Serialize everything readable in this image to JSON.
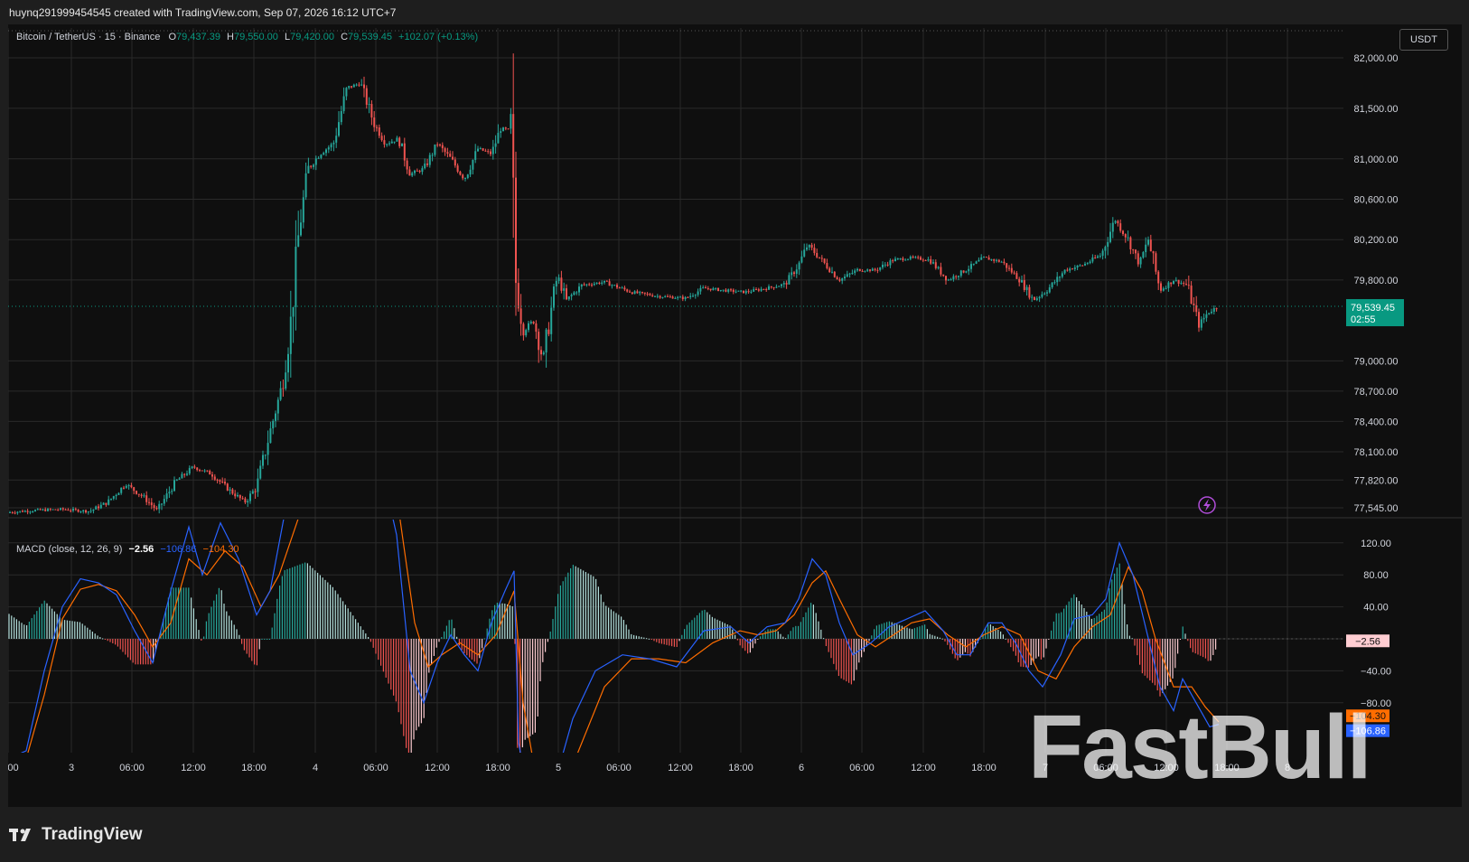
{
  "header": {
    "text": "huynq291999454545 created with TradingView.com, Sep 07, 2026 16:12 UTC+7"
  },
  "legend": {
    "symbol": "Bitcoin / TetherUS · 15 · Binance",
    "o_label": "O",
    "o": "79,437.39",
    "h_label": "H",
    "h": "79,550.00",
    "l_label": "L",
    "l": "79,420.00",
    "c_label": "C",
    "c": "79,539.45",
    "change": "+102.07 (+0.13%)"
  },
  "currency_button": "USDT",
  "price_tag": {
    "price": "79,539.45",
    "countdown": "02:55"
  },
  "macd_legend": {
    "title": "MACD (close, 12, 26, 9)",
    "hist": "−2.56",
    "macd": "−106.86",
    "signal": "−104.30"
  },
  "macd_tags": {
    "hist": "−2.56",
    "signal": "−104.30",
    "macd": "−106.86"
  },
  "footer": {
    "brand": "TradingView"
  },
  "watermark": {
    "text": "FastBull"
  },
  "colors": {
    "up": "#26a69a",
    "down": "#ef5350",
    "macd": "#2962ff",
    "signal": "#ff6d00",
    "price_tag": "#089981"
  },
  "chart_data": [
    {
      "type": "candlestick",
      "title": "Bitcoin / TetherUS · 15 · Binance",
      "price_axis_ticks": [
        82000,
        81500,
        81000,
        80600,
        80200,
        79800,
        79000,
        78700,
        78400,
        78100,
        77820,
        77545
      ],
      "price_axis_labels": [
        "82,000.00",
        "81,500.00",
        "81,000.00",
        "80,600.00",
        "80,200.00",
        "79,800.00",
        "79,000.00",
        "78,700.00",
        "78,400.00",
        "78,100.00",
        "77,820.00",
        "77,545.00"
      ],
      "time_axis_labels": [
        ":00",
        "3",
        "06:00",
        "12:00",
        "18:00",
        "4",
        "06:00",
        "12:00",
        "18:00",
        "5",
        "06:00",
        "12:00",
        "18:00",
        "6",
        "06:00",
        "12:00",
        "18:00",
        "7",
        "06:00",
        "12:00",
        "18:00",
        "8"
      ],
      "last_price": 79539.45,
      "close_path": [
        {
          "x": 0,
          "y": 77500
        },
        {
          "x": 30,
          "y": 77520
        },
        {
          "x": 60,
          "y": 77530
        },
        {
          "x": 90,
          "y": 77510
        },
        {
          "x": 110,
          "y": 77600
        },
        {
          "x": 130,
          "y": 77780
        },
        {
          "x": 150,
          "y": 77650
        },
        {
          "x": 165,
          "y": 77520
        },
        {
          "x": 185,
          "y": 77800
        },
        {
          "x": 205,
          "y": 77950
        },
        {
          "x": 225,
          "y": 77880
        },
        {
          "x": 245,
          "y": 77720
        },
        {
          "x": 262,
          "y": 77600
        },
        {
          "x": 275,
          "y": 77750
        },
        {
          "x": 290,
          "y": 78300
        },
        {
          "x": 303,
          "y": 78750
        },
        {
          "x": 312,
          "y": 79300
        },
        {
          "x": 322,
          "y": 80300
        },
        {
          "x": 332,
          "y": 80900
        },
        {
          "x": 345,
          "y": 81050
        },
        {
          "x": 360,
          "y": 81150
        },
        {
          "x": 375,
          "y": 81700
        },
        {
          "x": 390,
          "y": 81750
        },
        {
          "x": 405,
          "y": 81350
        },
        {
          "x": 418,
          "y": 81150
        },
        {
          "x": 432,
          "y": 81200
        },
        {
          "x": 445,
          "y": 80850
        },
        {
          "x": 460,
          "y": 80900
        },
        {
          "x": 475,
          "y": 81150
        },
        {
          "x": 490,
          "y": 81000
        },
        {
          "x": 505,
          "y": 80800
        },
        {
          "x": 520,
          "y": 81100
        },
        {
          "x": 535,
          "y": 81050
        },
        {
          "x": 545,
          "y": 81300
        },
        {
          "x": 557,
          "y": 81280
        },
        {
          "x": 561,
          "y": 79850
        },
        {
          "x": 570,
          "y": 79300
        },
        {
          "x": 582,
          "y": 79400
        },
        {
          "x": 592,
          "y": 79000
        },
        {
          "x": 600,
          "y": 79450
        },
        {
          "x": 608,
          "y": 79850
        },
        {
          "x": 618,
          "y": 79600
        },
        {
          "x": 635,
          "y": 79750
        },
        {
          "x": 660,
          "y": 79780
        },
        {
          "x": 690,
          "y": 79680
        },
        {
          "x": 720,
          "y": 79640
        },
        {
          "x": 750,
          "y": 79620
        },
        {
          "x": 770,
          "y": 79720
        },
        {
          "x": 790,
          "y": 79700
        },
        {
          "x": 815,
          "y": 79680
        },
        {
          "x": 840,
          "y": 79720
        },
        {
          "x": 860,
          "y": 79760
        },
        {
          "x": 875,
          "y": 79950
        },
        {
          "x": 885,
          "y": 80150
        },
        {
          "x": 900,
          "y": 80000
        },
        {
          "x": 920,
          "y": 79800
        },
        {
          "x": 940,
          "y": 79900
        },
        {
          "x": 960,
          "y": 79900
        },
        {
          "x": 980,
          "y": 80000
        },
        {
          "x": 1000,
          "y": 80020
        },
        {
          "x": 1020,
          "y": 80000
        },
        {
          "x": 1040,
          "y": 79800
        },
        {
          "x": 1060,
          "y": 79900
        },
        {
          "x": 1080,
          "y": 80020
        },
        {
          "x": 1100,
          "y": 79980
        },
        {
          "x": 1120,
          "y": 79800
        },
        {
          "x": 1135,
          "y": 79600
        },
        {
          "x": 1150,
          "y": 79700
        },
        {
          "x": 1170,
          "y": 79900
        },
        {
          "x": 1190,
          "y": 79950
        },
        {
          "x": 1210,
          "y": 80050
        },
        {
          "x": 1225,
          "y": 80400
        },
        {
          "x": 1240,
          "y": 80200
        },
        {
          "x": 1252,
          "y": 79950
        },
        {
          "x": 1262,
          "y": 80200
        },
        {
          "x": 1275,
          "y": 79700
        },
        {
          "x": 1290,
          "y": 79800
        },
        {
          "x": 1305,
          "y": 79750
        },
        {
          "x": 1318,
          "y": 79350
        },
        {
          "x": 1328,
          "y": 79480
        },
        {
          "x": 1340,
          "y": 79540
        }
      ]
    },
    {
      "type": "line",
      "title": "MACD (close, 12, 26, 9)",
      "y_axis_ticks": [
        120,
        80,
        40,
        0,
        -40,
        -80
      ],
      "y_axis_labels": [
        "120.00",
        "80.00",
        "40.00",
        "−2.56",
        "−40.00",
        "−80.00"
      ],
      "last_values": {
        "histogram": -2.56,
        "macd": -106.86,
        "signal": -104.3
      },
      "series": [
        {
          "name": "MACD",
          "points": [
            {
              "x": 0,
              "y": -150
            },
            {
              "x": 20,
              "y": -140
            },
            {
              "x": 40,
              "y": -40
            },
            {
              "x": 60,
              "y": 40
            },
            {
              "x": 80,
              "y": 75
            },
            {
              "x": 100,
              "y": 70
            },
            {
              "x": 120,
              "y": 55
            },
            {
              "x": 140,
              "y": 10
            },
            {
              "x": 160,
              "y": -30
            },
            {
              "x": 180,
              "y": 60
            },
            {
              "x": 200,
              "y": 140
            },
            {
              "x": 215,
              "y": 80
            },
            {
              "x": 235,
              "y": 145
            },
            {
              "x": 255,
              "y": 100
            },
            {
              "x": 275,
              "y": 30
            },
            {
              "x": 290,
              "y": 60
            },
            {
              "x": 305,
              "y": 150
            },
            {
              "x": 330,
              "y": 240
            },
            {
              "x": 360,
              "y": 300
            },
            {
              "x": 400,
              "y": 280
            },
            {
              "x": 430,
              "y": 130
            },
            {
              "x": 445,
              "y": -40
            },
            {
              "x": 460,
              "y": -80
            },
            {
              "x": 475,
              "y": -30
            },
            {
              "x": 490,
              "y": 5
            },
            {
              "x": 505,
              "y": -20
            },
            {
              "x": 520,
              "y": -40
            },
            {
              "x": 535,
              "y": 20
            },
            {
              "x": 550,
              "y": 60
            },
            {
              "x": 560,
              "y": 85
            },
            {
              "x": 565,
              "y": -130
            },
            {
              "x": 585,
              "y": -250
            },
            {
              "x": 600,
              "y": -200
            },
            {
              "x": 625,
              "y": -100
            },
            {
              "x": 650,
              "y": -40
            },
            {
              "x": 680,
              "y": -20
            },
            {
              "x": 710,
              "y": -25
            },
            {
              "x": 740,
              "y": -35
            },
            {
              "x": 770,
              "y": 10
            },
            {
              "x": 800,
              "y": 15
            },
            {
              "x": 820,
              "y": -5
            },
            {
              "x": 840,
              "y": 15
            },
            {
              "x": 860,
              "y": 20
            },
            {
              "x": 875,
              "y": 50
            },
            {
              "x": 890,
              "y": 100
            },
            {
              "x": 905,
              "y": 80
            },
            {
              "x": 920,
              "y": 20
            },
            {
              "x": 935,
              "y": -20
            },
            {
              "x": 955,
              "y": -5
            },
            {
              "x": 975,
              "y": 15
            },
            {
              "x": 995,
              "y": 25
            },
            {
              "x": 1015,
              "y": 35
            },
            {
              "x": 1035,
              "y": 10
            },
            {
              "x": 1050,
              "y": -20
            },
            {
              "x": 1065,
              "y": -20
            },
            {
              "x": 1085,
              "y": 20
            },
            {
              "x": 1100,
              "y": 20
            },
            {
              "x": 1115,
              "y": -5
            },
            {
              "x": 1130,
              "y": -40
            },
            {
              "x": 1145,
              "y": -60
            },
            {
              "x": 1165,
              "y": -20
            },
            {
              "x": 1180,
              "y": 25
            },
            {
              "x": 1200,
              "y": 30
            },
            {
              "x": 1215,
              "y": 50
            },
            {
              "x": 1230,
              "y": 120
            },
            {
              "x": 1245,
              "y": 80
            },
            {
              "x": 1260,
              "y": 10
            },
            {
              "x": 1275,
              "y": -60
            },
            {
              "x": 1290,
              "y": -90
            },
            {
              "x": 1300,
              "y": -50
            },
            {
              "x": 1315,
              "y": -80
            },
            {
              "x": 1330,
              "y": -110
            },
            {
              "x": 1340,
              "y": -107
            }
          ]
        },
        {
          "name": "Signal",
          "points": [
            {
              "x": 0,
              "y": -170
            },
            {
              "x": 20,
              "y": -150
            },
            {
              "x": 40,
              "y": -70
            },
            {
              "x": 60,
              "y": 25
            },
            {
              "x": 80,
              "y": 62
            },
            {
              "x": 100,
              "y": 68
            },
            {
              "x": 120,
              "y": 60
            },
            {
              "x": 140,
              "y": 30
            },
            {
              "x": 160,
              "y": -10
            },
            {
              "x": 180,
              "y": 20
            },
            {
              "x": 200,
              "y": 100
            },
            {
              "x": 220,
              "y": 80
            },
            {
              "x": 240,
              "y": 110
            },
            {
              "x": 260,
              "y": 90
            },
            {
              "x": 280,
              "y": 40
            },
            {
              "x": 300,
              "y": 80
            },
            {
              "x": 330,
              "y": 180
            },
            {
              "x": 360,
              "y": 260
            },
            {
              "x": 400,
              "y": 280
            },
            {
              "x": 430,
              "y": 180
            },
            {
              "x": 450,
              "y": 20
            },
            {
              "x": 465,
              "y": -35
            },
            {
              "x": 480,
              "y": -20
            },
            {
              "x": 500,
              "y": -5
            },
            {
              "x": 520,
              "y": -20
            },
            {
              "x": 540,
              "y": 5
            },
            {
              "x": 560,
              "y": 60
            },
            {
              "x": 570,
              "y": -80
            },
            {
              "x": 590,
              "y": -210
            },
            {
              "x": 610,
              "y": -200
            },
            {
              "x": 635,
              "y": -130
            },
            {
              "x": 660,
              "y": -60
            },
            {
              "x": 690,
              "y": -25
            },
            {
              "x": 720,
              "y": -25
            },
            {
              "x": 750,
              "y": -30
            },
            {
              "x": 780,
              "y": -5
            },
            {
              "x": 810,
              "y": 10
            },
            {
              "x": 830,
              "y": 5
            },
            {
              "x": 850,
              "y": 10
            },
            {
              "x": 870,
              "y": 30
            },
            {
              "x": 890,
              "y": 70
            },
            {
              "x": 905,
              "y": 85
            },
            {
              "x": 920,
              "y": 50
            },
            {
              "x": 940,
              "y": 5
            },
            {
              "x": 960,
              "y": -10
            },
            {
              "x": 980,
              "y": 5
            },
            {
              "x": 1000,
              "y": 20
            },
            {
              "x": 1020,
              "y": 25
            },
            {
              "x": 1040,
              "y": 5
            },
            {
              "x": 1060,
              "y": -10
            },
            {
              "x": 1080,
              "y": 5
            },
            {
              "x": 1100,
              "y": 15
            },
            {
              "x": 1120,
              "y": 5
            },
            {
              "x": 1140,
              "y": -40
            },
            {
              "x": 1160,
              "y": -50
            },
            {
              "x": 1180,
              "y": -10
            },
            {
              "x": 1200,
              "y": 15
            },
            {
              "x": 1220,
              "y": 30
            },
            {
              "x": 1240,
              "y": 90
            },
            {
              "x": 1255,
              "y": 60
            },
            {
              "x": 1270,
              "y": 0
            },
            {
              "x": 1290,
              "y": -60
            },
            {
              "x": 1310,
              "y": -60
            },
            {
              "x": 1325,
              "y": -85
            },
            {
              "x": 1340,
              "y": -104
            }
          ]
        }
      ]
    }
  ]
}
